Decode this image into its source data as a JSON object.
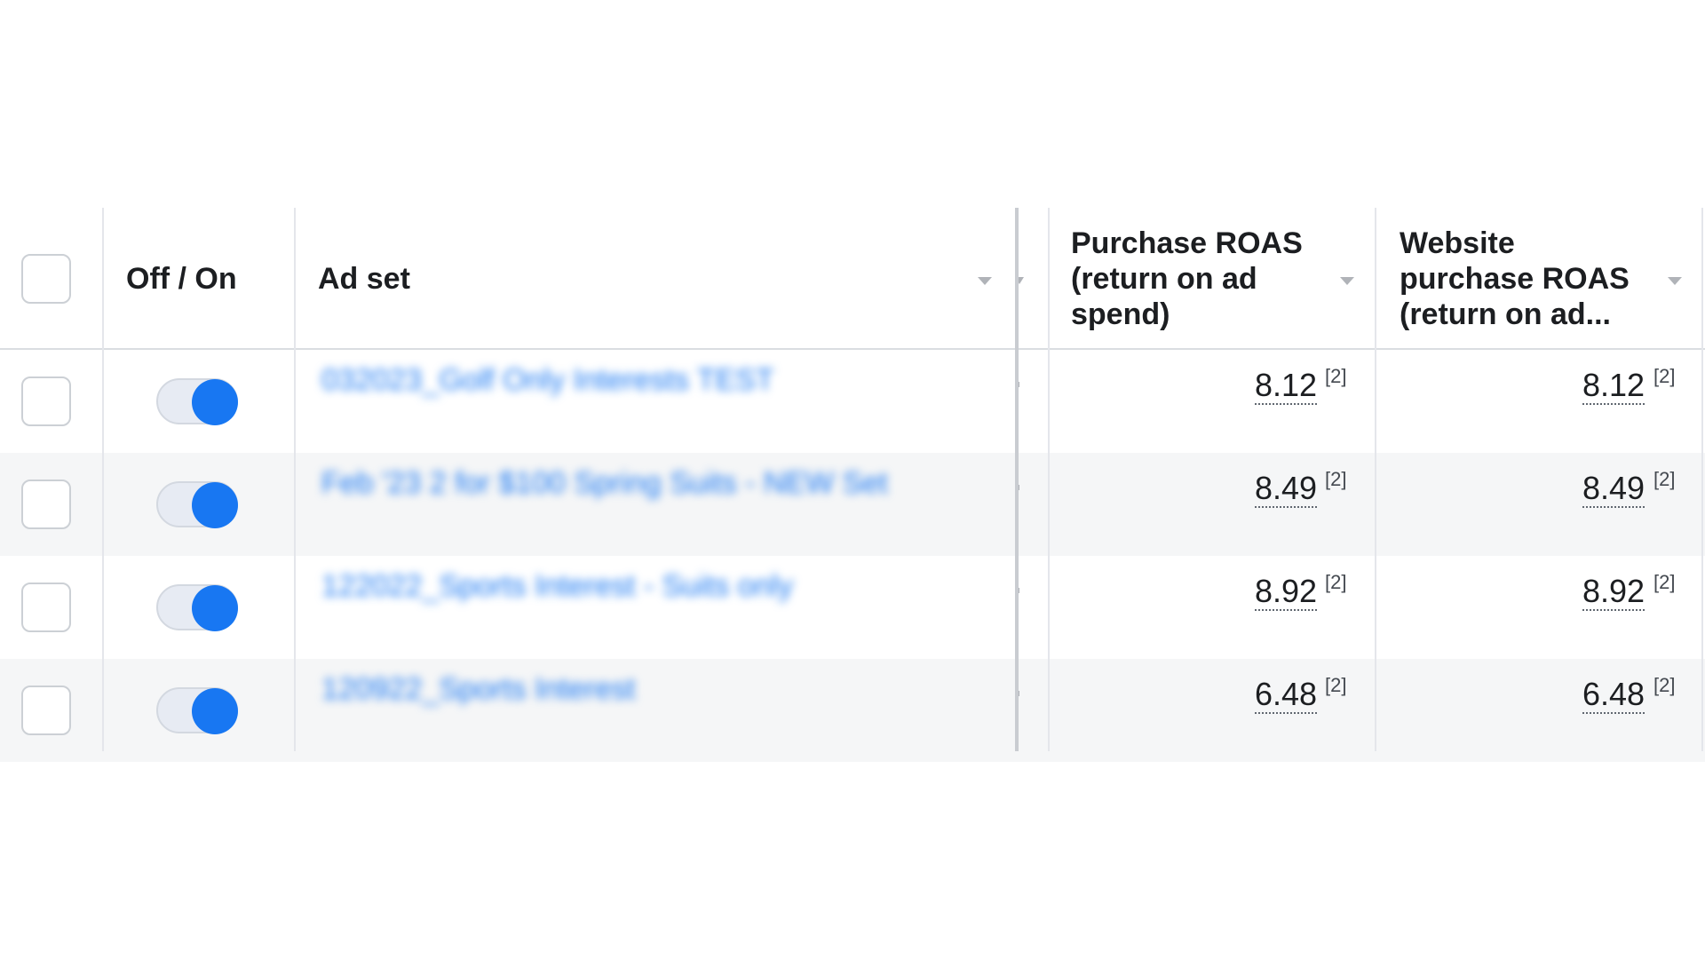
{
  "columns": {
    "off_on": "Off / On",
    "ad_set": "Ad set",
    "purchase_roas": "Purchase ROAS (return on ad spend)",
    "website_purchase_roas": "Website purchase ROAS (return on ad..."
  },
  "rows": [
    {
      "ad_set": "032023_Golf Only Interests TEST",
      "enabled": true,
      "purchase_roas": "8.12",
      "purchase_roas_note": "[2]",
      "website_purchase_roas": "8.12",
      "website_purchase_roas_note": "[2]"
    },
    {
      "ad_set": "Feb '23 2 for $100 Spring Suits - NEW Set",
      "enabled": true,
      "purchase_roas": "8.49",
      "purchase_roas_note": "[2]",
      "website_purchase_roas": "8.49",
      "website_purchase_roas_note": "[2]"
    },
    {
      "ad_set": "122022_Sports Interest - Suits only",
      "enabled": true,
      "purchase_roas": "8.92",
      "purchase_roas_note": "[2]",
      "website_purchase_roas": "8.92",
      "website_purchase_roas_note": "[2]"
    },
    {
      "ad_set": "120922_Sports Interest",
      "enabled": true,
      "purchase_roas": "6.48",
      "purchase_roas_note": "[2]",
      "website_purchase_roas": "6.48",
      "website_purchase_roas_note": "[2]"
    }
  ],
  "colors": {
    "toggle_on": "#1877f2",
    "link": "#1877f2",
    "row_alt": "#f5f6f7"
  },
  "icons": {
    "sort": "caret-down-icon"
  }
}
